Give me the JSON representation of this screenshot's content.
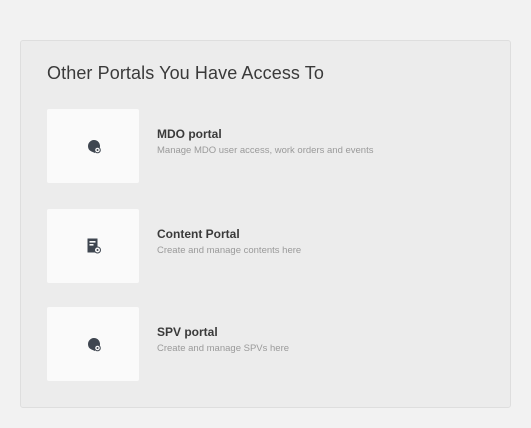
{
  "section": {
    "title": "Other Portals You Have Access To"
  },
  "portals": [
    {
      "name": "MDO portal",
      "description": "Manage MDO user access, work orders and events",
      "icon": "portal-icon"
    },
    {
      "name": "Content Portal",
      "description": "Create and manage contents here",
      "icon": "content-icon"
    },
    {
      "name": "SPV portal",
      "description": "Create and manage SPVs here",
      "icon": "portal-icon"
    }
  ],
  "colors": {
    "background": "#f2f2f2",
    "card": "#ececec",
    "icon_box": "#fafafa",
    "title": "#3a3a3a",
    "description": "#9a9a9a",
    "icon": "#3f4650"
  }
}
